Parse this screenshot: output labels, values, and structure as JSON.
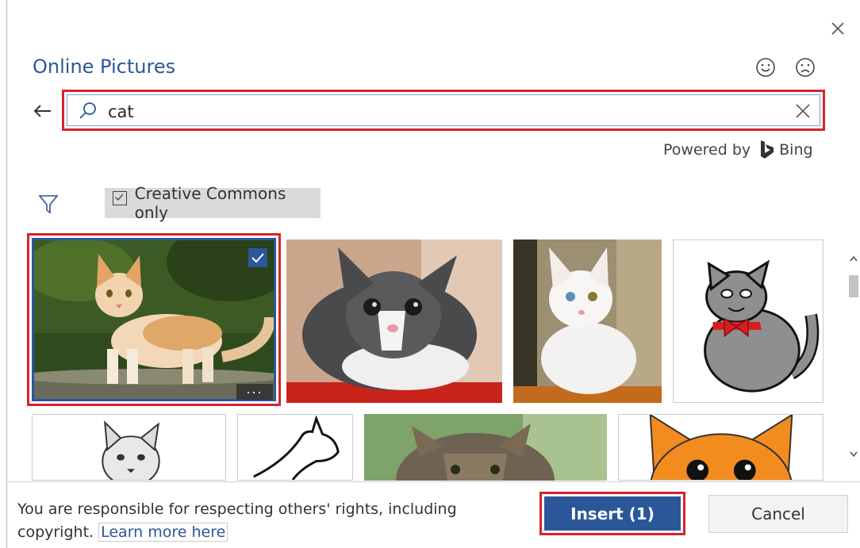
{
  "dialog": {
    "title": "Online Pictures"
  },
  "search": {
    "query": "cat"
  },
  "powered_by": {
    "label": "Powered by",
    "provider": "Bing"
  },
  "filter": {
    "creative_commons_label": "Creative Commons only",
    "creative_commons_checked": true
  },
  "results": [
    {
      "name": "orange-white-kitten-photo",
      "selected": true
    },
    {
      "name": "gray-white-kitten-photo",
      "selected": false
    },
    {
      "name": "white-kitten-photo",
      "selected": false
    },
    {
      "name": "gray-cartoon-cat-red-bow",
      "selected": false
    },
    {
      "name": "cat-sketch-drawing",
      "selected": false
    },
    {
      "name": "cat-line-art",
      "selected": false
    },
    {
      "name": "tabby-cat-photo",
      "selected": false
    },
    {
      "name": "orange-cartoon-cat-face",
      "selected": false
    }
  ],
  "more_options_label": "...",
  "footer": {
    "notice": "You are responsible for respecting others' rights, including copyright.",
    "learn_more": "Learn more here"
  },
  "buttons": {
    "insert": "Insert (1)",
    "cancel": "Cancel"
  },
  "colors": {
    "accent": "#2b579a",
    "highlight": "#d6232b"
  },
  "icons": [
    "close-icon",
    "smile-icon",
    "frown-icon",
    "back-arrow-icon",
    "search-icon",
    "clear-icon",
    "bing-logo-icon",
    "filter-icon",
    "checkbox-icon",
    "checkmark-icon",
    "more-options-icon",
    "scroll-up-icon",
    "scroll-down-icon"
  ]
}
